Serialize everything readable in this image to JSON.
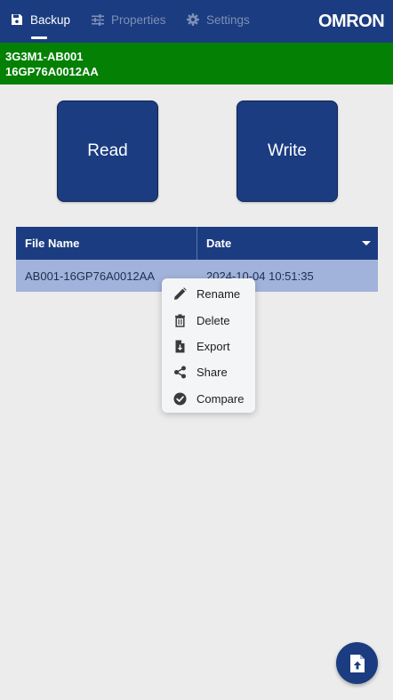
{
  "nav": {
    "tabs": [
      {
        "label": "Backup",
        "icon": "save-icon",
        "active": true
      },
      {
        "label": "Properties",
        "icon": "sliders-icon",
        "active": false
      },
      {
        "label": "Settings",
        "icon": "gear-icon",
        "active": false
      }
    ],
    "logo": "OMRON"
  },
  "device": {
    "model": "3G3M1-AB001",
    "serial": "16GP76A0012AA"
  },
  "actions": {
    "read_label": "Read",
    "write_label": "Write"
  },
  "table": {
    "columns": [
      "File Name",
      "Date"
    ],
    "sort": "descending",
    "rows": [
      {
        "file_name": "AB001-16GP76A0012AA",
        "date": "2024-10-04 10:51:35"
      }
    ]
  },
  "context_menu": {
    "items": [
      {
        "label": "Rename",
        "icon": "pencil-icon"
      },
      {
        "label": "Delete",
        "icon": "trash-icon"
      },
      {
        "label": "Export",
        "icon": "file-download-icon"
      },
      {
        "label": "Share",
        "icon": "share-icon"
      },
      {
        "label": "Compare",
        "icon": "check-circle-icon"
      }
    ]
  },
  "fab": {
    "icon": "file-upload-icon"
  },
  "colors": {
    "primary": "#1b3c80",
    "banner": "#048004",
    "row_selected": "#a1b3da",
    "background": "#ececec"
  }
}
